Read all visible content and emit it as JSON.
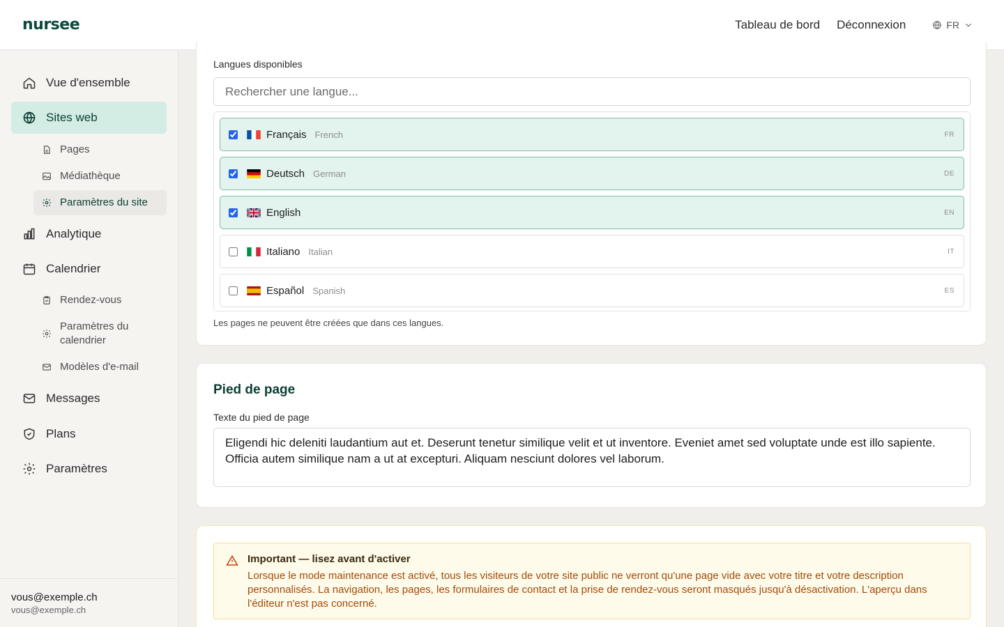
{
  "header": {
    "logo": "nursee",
    "nav": [
      "Tableau de bord",
      "Déconnexion"
    ],
    "language": "FR"
  },
  "sidebar": {
    "items": [
      {
        "label": "Vue d'ensemble",
        "icon": "home-icon"
      },
      {
        "label": "Sites web",
        "icon": "globe-icon",
        "active": true
      },
      {
        "label": "Pages",
        "icon": "document-icon",
        "sub": true
      },
      {
        "label": "Médiathèque",
        "icon": "image-icon",
        "sub": true
      },
      {
        "label": "Paramètres du site",
        "icon": "gear-icon",
        "sub": true,
        "active": true
      },
      {
        "label": "Analytique",
        "icon": "bar-chart-icon"
      },
      {
        "label": "Calendrier",
        "icon": "calendar-icon"
      },
      {
        "label": "Rendez-vous",
        "icon": "clipboard-icon",
        "sub": true
      },
      {
        "label": "Paramètres du calendrier",
        "icon": "gear-icon",
        "sub": true
      },
      {
        "label": "Modèles d'e-mail",
        "icon": "mail-icon",
        "sub": true
      },
      {
        "label": "Messages",
        "icon": "mail-icon"
      },
      {
        "label": "Plans",
        "icon": "shield-icon"
      },
      {
        "label": "Paramètres",
        "icon": "gear-icon"
      }
    ],
    "user": {
      "name": "vous@exemple.ch",
      "email": "vous@exemple.ch"
    }
  },
  "languages": {
    "label": "Langues disponibles",
    "search_placeholder": "Rechercher une langue...",
    "items": [
      {
        "native": "Français",
        "english": "French",
        "code": "FR",
        "checked": true
      },
      {
        "native": "Deutsch",
        "english": "German",
        "code": "DE",
        "checked": true
      },
      {
        "native": "English",
        "english": "",
        "code": "EN",
        "checked": true
      },
      {
        "native": "Italiano",
        "english": "Italian",
        "code": "IT",
        "checked": false
      },
      {
        "native": "Español",
        "english": "Spanish",
        "code": "ES",
        "checked": false
      }
    ],
    "helper": "Les pages ne peuvent être créées que dans ces langues."
  },
  "footer": {
    "title": "Pied de page",
    "label": "Texte du pied de page",
    "value": "Eligendi hic deleniti laudantium aut et. Deserunt tenetur similique velit et ut inventore. Eveniet amet sed voluptate unde est illo sapiente. Officia autem similique nam a ut at excepturi. Aliquam nesciunt dolores vel laborum."
  },
  "maintenance": {
    "alert_title": "Important — lisez avant d'activer",
    "alert_text": "Lorsque le mode maintenance est activé, tous les visiteurs de votre site public ne verront qu'une page vide avec votre titre et votre description personnalisés. La navigation, les pages, les formulaires de contact et la prise de rendez-vous seront masqués jusqu'à désactivation. L'aperçu dans l'éditeur n'est pas concerné."
  },
  "colors": {
    "brand": "#0b4a3c",
    "active_bg": "#d3ece4",
    "checked_row_bg": "#e3f3ee",
    "alert_bg": "#fefbea",
    "alert_text": "#a34a0b"
  }
}
